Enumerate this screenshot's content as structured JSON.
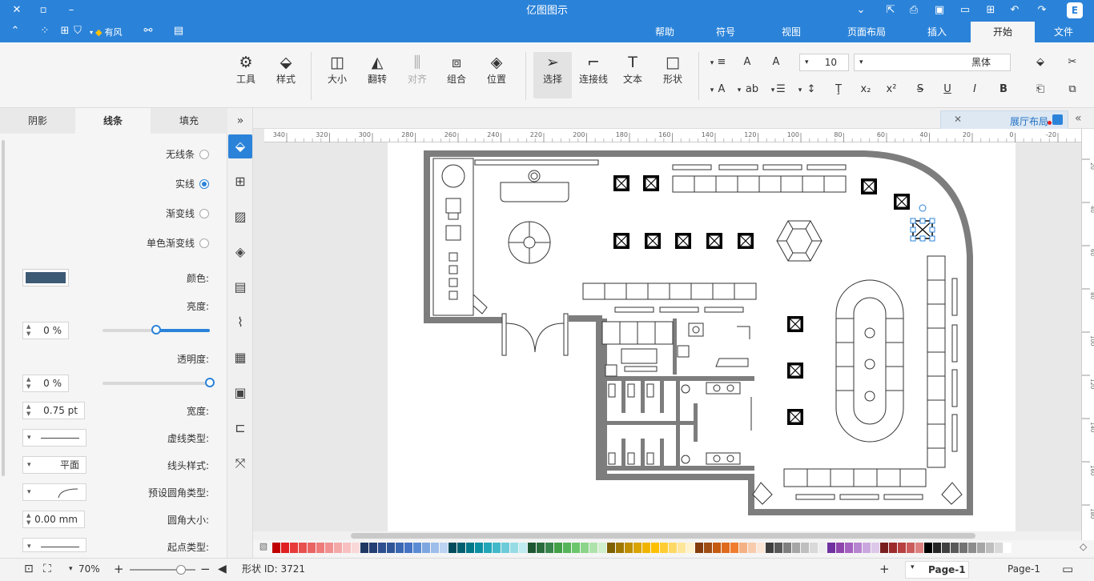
{
  "window": {
    "title": "亿图图示"
  },
  "menu": {
    "tabs": [
      "文件",
      "开始",
      "插入",
      "页面布局",
      "视图",
      "符号",
      "帮助"
    ],
    "active": "开始",
    "brand_label": "有风"
  },
  "ribbon": {
    "tools": [
      {
        "label": "工具",
        "icon": "tools-icon"
      },
      {
        "label": "样式",
        "icon": "paint-bucket-icon"
      },
      {
        "label": "大小",
        "icon": "size-icon"
      },
      {
        "label": "翻转",
        "icon": "flip-icon"
      },
      {
        "label": "对齐",
        "icon": "align-icon",
        "disabled": true
      },
      {
        "label": "组合",
        "icon": "group-icon"
      },
      {
        "label": "位置",
        "icon": "layers-icon"
      },
      {
        "label": "选择",
        "icon": "pointer-icon",
        "selected": true
      },
      {
        "label": "连接线",
        "icon": "connector-icon"
      },
      {
        "label": "文本",
        "icon": "text-icon"
      },
      {
        "label": "形状",
        "icon": "shape-icon"
      }
    ],
    "font_name": "黑体",
    "font_size": "10"
  },
  "panel": {
    "tabs": [
      "阴影",
      "线条",
      "填充"
    ],
    "active_tab": "线条",
    "line_options": [
      "无线条",
      "实线",
      "渐变线",
      "单色渐变线"
    ],
    "selected_line_option": "实线",
    "labels": {
      "color": "颜色:",
      "shade": "亮度:",
      "transparency": "透明度:",
      "width": "宽度:",
      "dash_type": "虚线类型:",
      "cap_type": "线头样式:",
      "preset_round": "预设圆角类型:",
      "round_size": "圆角大小:",
      "start_type": "起点类型:"
    },
    "values": {
      "line_color": "#3d5a75",
      "shade": "0 %",
      "shade_level": 0.5,
      "transparency": "0 %",
      "transparency_level": 0,
      "width": "0.75 pt",
      "cap_type": "平面",
      "round_size": "0.00 mm"
    }
  },
  "document": {
    "tab_label": "展厅布局"
  },
  "ruler": {
    "ticks": [
      "340",
      "320",
      "300",
      "280",
      "260",
      "240",
      "220",
      "200",
      "180",
      "160",
      "140",
      "120",
      "100",
      "80",
      "60",
      "40",
      "20",
      "0",
      "-20"
    ],
    "vticks": [
      "20",
      "40",
      "60",
      "80",
      "100",
      "120",
      "140",
      "160",
      "180"
    ]
  },
  "status": {
    "page_tab": "Page-1",
    "page_tab2": "Page-1",
    "shape_id": "形状 ID: 3721",
    "zoom": "70%"
  },
  "palette": [
    "#c00000",
    "#e02020",
    "#e83a3a",
    "#e85050",
    "#ea6464",
    "#ee7a7a",
    "#f19090",
    "#f5a8a8",
    "#f8c0c0",
    "#fbd8d8",
    "#1f3864",
    "#243f74",
    "#2e4f8f",
    "#2f5597",
    "#3a67b2",
    "#4472c4",
    "#5b8bd4",
    "#7ea6e0",
    "#9dbdea",
    "#bcd3f2",
    "#004c5c",
    "#006070",
    "#00788a",
    "#0a8fa3",
    "#20a6b8",
    "#42b9c9",
    "#6ccbd8",
    "#97dce5",
    "#c0ebf0",
    "#1e5631",
    "#2a6b3e",
    "#37854c",
    "#43a047",
    "#56b55a",
    "#6cc66c",
    "#8bd48a",
    "#aee2ab",
    "#d0efcd",
    "#7f6000",
    "#a07800",
    "#bf8f00",
    "#d9a400",
    "#f0b400",
    "#ffc000",
    "#ffcd33",
    "#ffd966",
    "#ffe699",
    "#fff2cc",
    "#843c0c",
    "#a04d14",
    "#c55a11",
    "#e06a1e",
    "#f07d2f",
    "#f4b183",
    "#f8cbad",
    "#fbe5d6",
    "#3f3f3f",
    "#595959",
    "#7f7f7f",
    "#a5a5a5",
    "#bfbfbf",
    "#d9d9d9",
    "#eeeeee",
    "#7030a0",
    "#8e44ad",
    "#a461c0",
    "#b784d0",
    "#cba7df",
    "#ddc8ea",
    "#7a1f1f",
    "#9c2b2b",
    "#b84040",
    "#cc5c5c",
    "#dd8080",
    "#000000",
    "#262626",
    "#404040",
    "#595959",
    "#737373",
    "#8c8c8c",
    "#a6a6a6",
    "#bfbfbf",
    "#d9d9d9",
    "#ffffff"
  ]
}
